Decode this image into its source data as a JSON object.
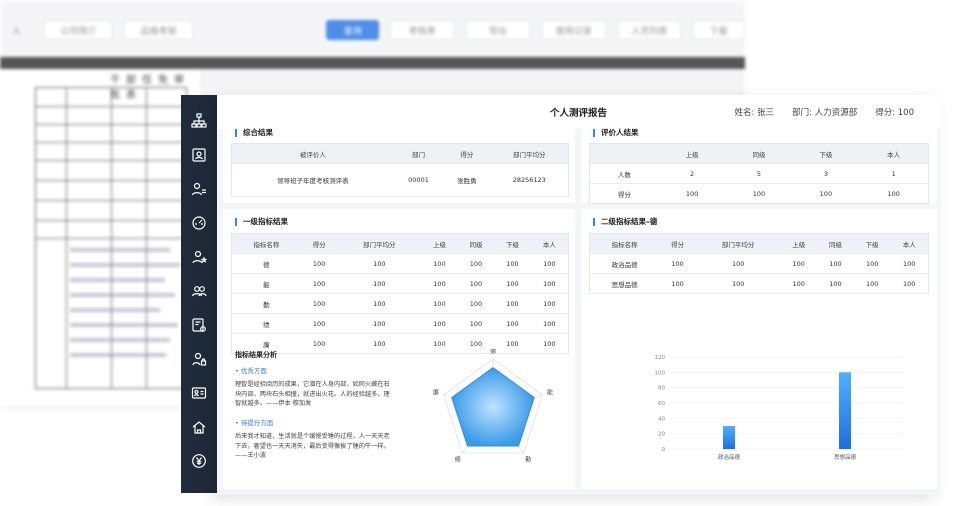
{
  "report": {
    "title": "个人测评报告",
    "meta": {
      "name": "姓名: 张三",
      "dept": "部门: 人力资源部",
      "score": "得分: 100"
    }
  },
  "summary": {
    "title": "综合结果",
    "headers": [
      "被评价人",
      "部门",
      "得分",
      "部门平均分"
    ],
    "row": [
      "领导班子年度考核测评表",
      "00001",
      "张胜勇",
      "28256123"
    ]
  },
  "evaluator": {
    "title": "评价人结果",
    "headers": [
      "",
      "上级",
      "同级",
      "下级",
      "本人"
    ],
    "rows": [
      [
        "人数",
        "2",
        "5",
        "3",
        "1"
      ],
      [
        "得分",
        "100",
        "100",
        "100",
        "100"
      ]
    ]
  },
  "level1": {
    "title": "一级指标结果",
    "headers": [
      "指标名称",
      "得分",
      "部门平均分",
      "上级",
      "同级",
      "下级",
      "本人"
    ],
    "rows": [
      [
        "德",
        "100",
        "100",
        "100",
        "100",
        "100",
        "100"
      ],
      [
        "能",
        "100",
        "100",
        "100",
        "100",
        "100",
        "100"
      ],
      [
        "勤",
        "100",
        "100",
        "100",
        "100",
        "100",
        "100"
      ],
      [
        "绩",
        "100",
        "100",
        "100",
        "100",
        "100",
        "100"
      ],
      [
        "廉",
        "100",
        "100",
        "100",
        "100",
        "100",
        "100"
      ]
    ]
  },
  "level2": {
    "title": "二级指标结果–德",
    "headers": [
      "指标名称",
      "得分",
      "部门平均分",
      "上级",
      "同级",
      "下级",
      "本人"
    ],
    "rows": [
      [
        "政治品德",
        "100",
        "100",
        "100",
        "100",
        "100",
        "100"
      ],
      [
        "思想品德",
        "100",
        "100",
        "100",
        "100",
        "100",
        "100"
      ]
    ]
  },
  "analysis": {
    "title": "指标结果分析",
    "strength_label": "• 优秀方面",
    "strength_text": "理智是经验阅历的成果，它潜在人身内部，如同火藏在石块内部。两块石头相撞，就进出火花。人的经验越多，理智就越多。——伊本·穆加发",
    "improve_label": "• 待提升方面",
    "improve_text": "后来我才知道，生活就是个缓慢受锤的过程，人一天天老下去，奢望也一天天消失，最后变得像挨了锤的牛一样。——王小波"
  },
  "colors": {
    "accent": "#3b82e6",
    "sidebar": "#1f2a3a"
  },
  "chart_data": [
    {
      "type": "radar",
      "categories": [
        "德",
        "能",
        "勤",
        "绩",
        "廉"
      ],
      "values": [
        100,
        100,
        100,
        100,
        100
      ],
      "max": 120
    },
    {
      "type": "bar",
      "categories": [
        "政治品德",
        "思想品德"
      ],
      "values": [
        30,
        100
      ],
      "ylim": [
        0,
        120
      ],
      "yticks": [
        "0",
        "20",
        "40",
        "60",
        "80",
        "100",
        "120"
      ]
    }
  ],
  "background": {
    "toolbar": [
      "人",
      "公司简介",
      "品格考核",
      "查询",
      "考核表",
      "导出",
      "使用记录",
      "人员列表",
      "下载"
    ],
    "doc_title": "干部任免审批表"
  },
  "sidebar_icons": [
    "org-chart-icon",
    "id-card-icon",
    "user-list-icon",
    "gauge-icon",
    "user-star-icon",
    "users-icon",
    "settings-doc-icon",
    "user-lock-icon",
    "profile-card-icon",
    "home-icon",
    "yen-icon"
  ]
}
